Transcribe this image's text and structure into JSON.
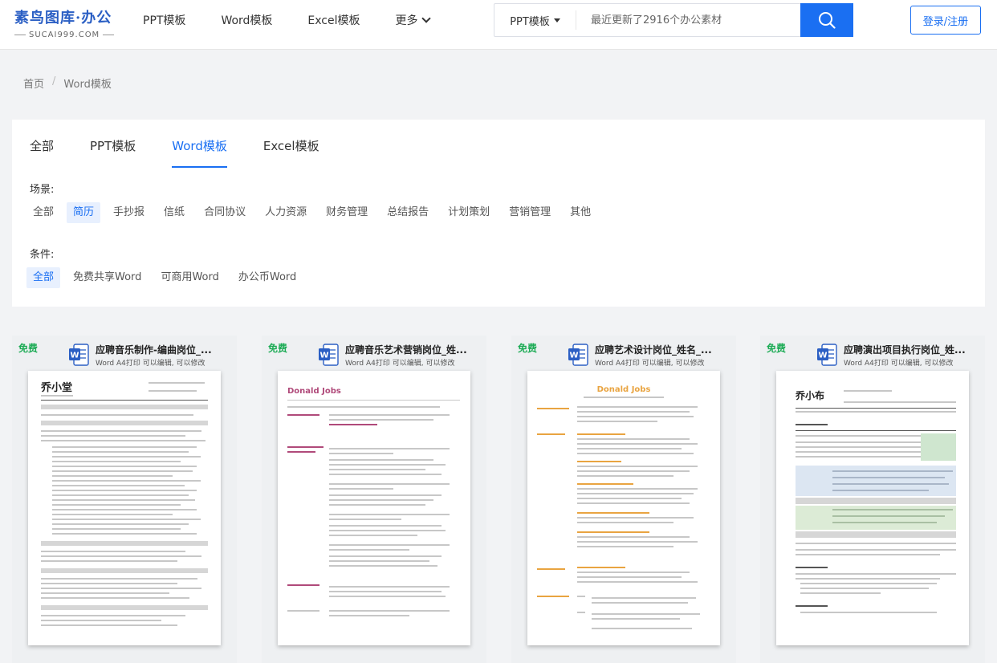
{
  "brand": {
    "logo_main": "素鸟图库·办公",
    "logo_sub": "SUCAI999.COM"
  },
  "nav": {
    "items": [
      "PPT模板",
      "Word模板",
      "Excel模板",
      "更多"
    ]
  },
  "search": {
    "type": "PPT模板",
    "placeholder": "最近更新了2916个办公素材"
  },
  "auth": {
    "login_label": "登录/注册"
  },
  "breadcrumb": {
    "home": "首页",
    "sep": "/",
    "current": "Word模板"
  },
  "tabs": [
    "全部",
    "PPT模板",
    "Word模板",
    "Excel模板"
  ],
  "filters": {
    "scene_label": "场景:",
    "scene_items": [
      "全部",
      "简历",
      "手抄报",
      "信纸",
      "合同协议",
      "人力资源",
      "财务管理",
      "总结报告",
      "计划策划",
      "营销管理",
      "其他"
    ],
    "condition_label": "条件:",
    "condition_items": [
      "全部",
      "免费共享Word",
      "可商用Word",
      "办公币Word"
    ]
  },
  "cards": [
    {
      "badge": "免费",
      "title": "应聘音乐制作-编曲岗位_...",
      "subtitle": "Word A4打印 可以编辑, 可以修改",
      "doc_name": "乔小堂"
    },
    {
      "badge": "免费",
      "title": "应聘音乐艺术营销岗位_姓...",
      "subtitle": "Word A4打印 可以编辑, 可以修改",
      "doc_name": "Donald Jobs"
    },
    {
      "badge": "免费",
      "title": "应聘艺术设计岗位_姓名_...",
      "subtitle": "Word A4打印 可以编辑, 可以修改",
      "doc_name": "Donald Jobs"
    },
    {
      "badge": "免费",
      "title": "应聘演出项目执行岗位_姓...",
      "subtitle": "Word A4打印 可以编辑, 可以修改",
      "doc_name": "乔小布"
    }
  ],
  "colors": {
    "accent": "#1a6ff2",
    "free": "#1cab55",
    "word": "#2b5fc4"
  },
  "icons": {
    "search": "search-icon",
    "word": "word-file-icon",
    "chevron": "chevron-down-icon"
  }
}
